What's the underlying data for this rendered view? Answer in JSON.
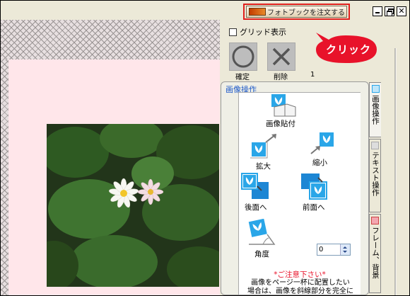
{
  "toolbar": {
    "order_label": "フォトブックを注文する"
  },
  "window_controls": {
    "close_glyph": "✕"
  },
  "callout": {
    "text": "クリック",
    "color": "#e8122a"
  },
  "grid_option": {
    "label": "グリッド表示",
    "checked": false
  },
  "actions": {
    "confirm_label": "確定",
    "delete_label": "削除",
    "count": "1"
  },
  "panel": {
    "title": "画像操作",
    "paste_label": "画像貼付",
    "enlarge_label": "拡大",
    "shrink_label": "縮小",
    "back_label": "後面へ",
    "front_label": "前面へ",
    "angle_label": "角度",
    "angle_value": "0",
    "warning_title": "*ご注意下さい*",
    "note_line1": "画像をページ一杯に配置したい",
    "note_line2": "場合は、画像を斜線部分を完全に"
  },
  "tabs": [
    {
      "label": "画像操作",
      "active": true
    },
    {
      "label": "テキスト操作",
      "active": false
    },
    {
      "label": "フレーム、背景",
      "active": false
    }
  ],
  "colors": {
    "accent_blue": "#1c58c8",
    "highlight_red": "#e0201c",
    "canvas_pink": "#ffe6ea"
  }
}
